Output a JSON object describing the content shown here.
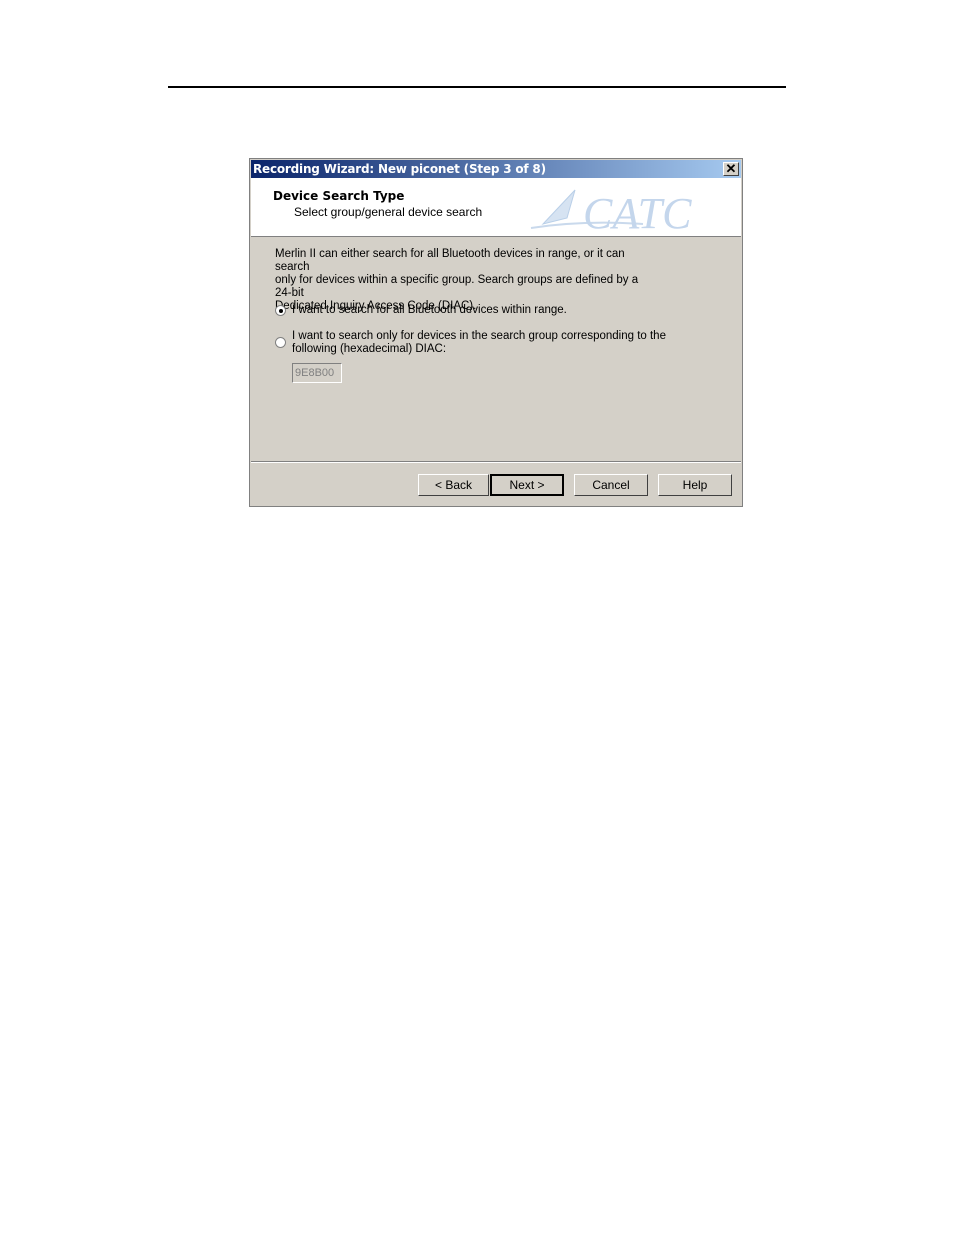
{
  "dialog": {
    "title": "Recording Wizard: New piconet (Step 3 of 8)",
    "close_symbol": "✕",
    "header": {
      "title": "Device Search Type",
      "subtitle": "Select group/general device search",
      "logo_text": "CATC",
      "logo_icon": "catc-logo-icon"
    },
    "intro": [
      "Merlin II  can either search for all Bluetooth devices in range, or it can search",
      "only for devices within a specific group.  Search groups are defined by a 24-bit",
      "Dedicated Inquiry Access Code (DIAC)."
    ],
    "options": [
      {
        "label": "I want to search for all Bluetooth devices within range.",
        "selected": true
      },
      {
        "label_lines": [
          "I want to search only for devices in the search group corresponding to the",
          "following (hexadecimal) DIAC:"
        ],
        "selected": false
      }
    ],
    "diac_value": "9E8B00",
    "buttons": {
      "back": "< Back",
      "next": "Next >",
      "cancel": "Cancel",
      "help": "Help"
    }
  },
  "colors": {
    "dialog_bg": "#d4d0c8",
    "titlebar_start": "#0a246a",
    "titlebar_end": "#a6caf0",
    "logo": "#b9cfe8"
  }
}
